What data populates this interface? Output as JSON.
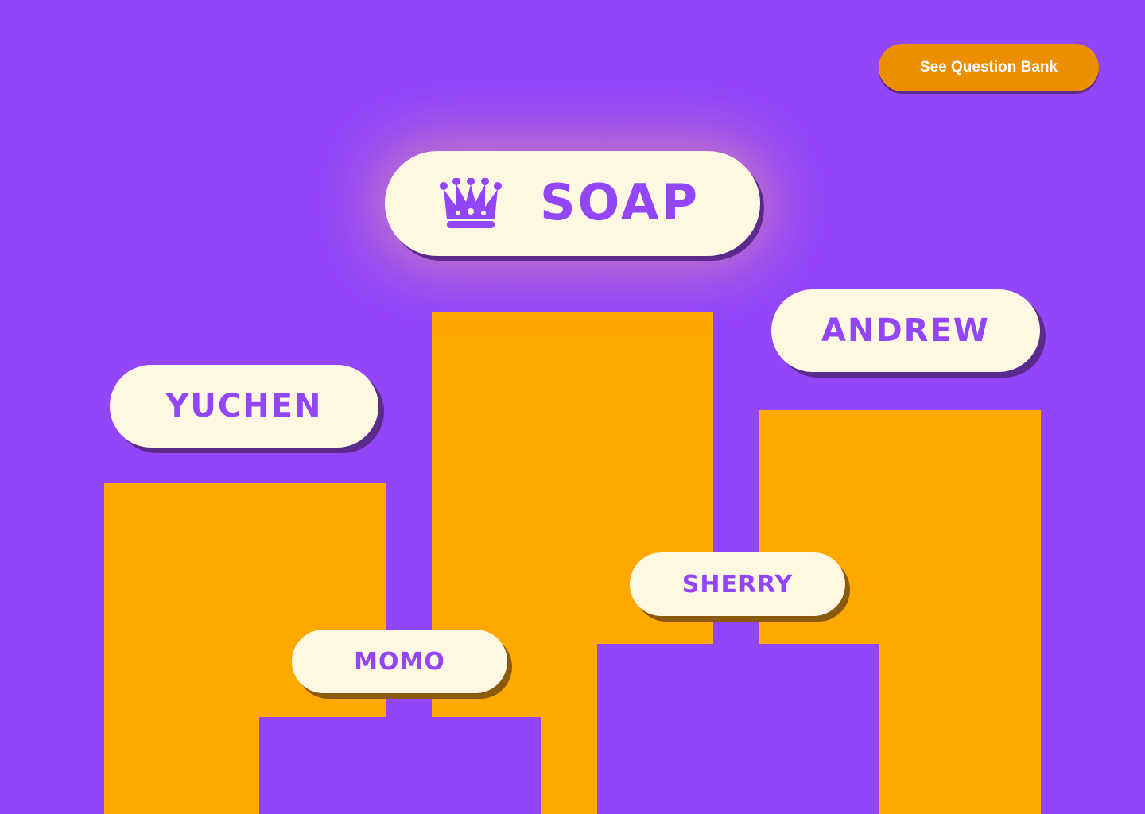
{
  "header": {
    "question_bank_label": "See Question Bank"
  },
  "leaderboard": {
    "winner": {
      "name": "SOAP",
      "icon": "crown-icon"
    },
    "players": [
      {
        "name": "YUCHEN"
      },
      {
        "name": "ANDREW"
      },
      {
        "name": "MOMO"
      },
      {
        "name": "SHERRY"
      }
    ]
  },
  "colors": {
    "background": "#9346F8",
    "bar": "#FFA800",
    "pill": "#FEF8E2",
    "text": "#9346F8",
    "button": "#EB8E00",
    "button_text": "#FFFFFF"
  }
}
